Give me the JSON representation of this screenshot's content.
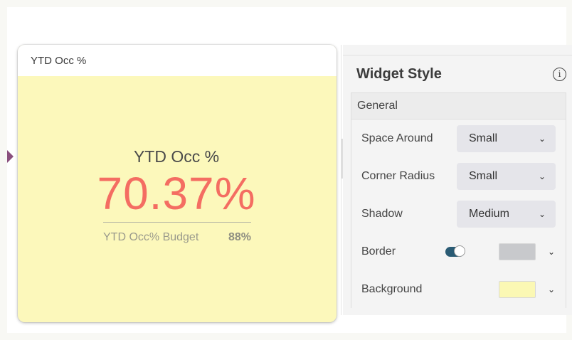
{
  "widget": {
    "header_title": "YTD Occ %",
    "kpi_label": "YTD Occ %",
    "kpi_value": "70.37%",
    "compare_label": "YTD Occ% Budget",
    "compare_value": "88%",
    "background_color": "#fcf8bb",
    "value_color": "#f46d62"
  },
  "panel": {
    "title": "Widget Style",
    "info_icon": "info-icon",
    "section": "General",
    "rows": [
      {
        "label": "Space Around",
        "value": "Small"
      },
      {
        "label": "Corner Radius",
        "value": "Small"
      },
      {
        "label": "Shadow",
        "value": "Medium"
      }
    ],
    "border": {
      "label": "Border",
      "enabled": true,
      "color": "#c8c9cc"
    },
    "background": {
      "label": "Background",
      "color": "#fbf8b4"
    }
  }
}
